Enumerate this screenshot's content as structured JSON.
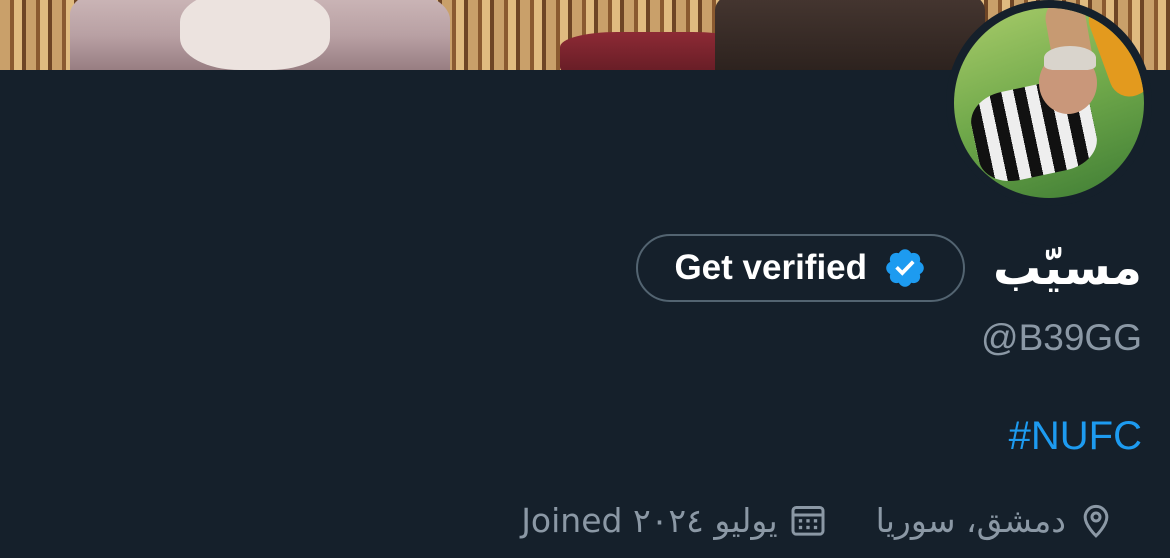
{
  "profile": {
    "display_name": "مسيّب",
    "handle": "@B39GG",
    "get_verified_label": "Get verified",
    "bio_hashtag": "#NUFC",
    "location": "دمشق، سوريا",
    "joined": "Joined يوليو ٢٠٢٤"
  },
  "icons": {
    "verified": "verified-badge-icon",
    "location": "location-pin-icon",
    "calendar": "calendar-icon"
  },
  "colors": {
    "background": "#15202b",
    "accent": "#1d9bf0",
    "secondary_text": "#8b98a5",
    "border": "#536471"
  }
}
